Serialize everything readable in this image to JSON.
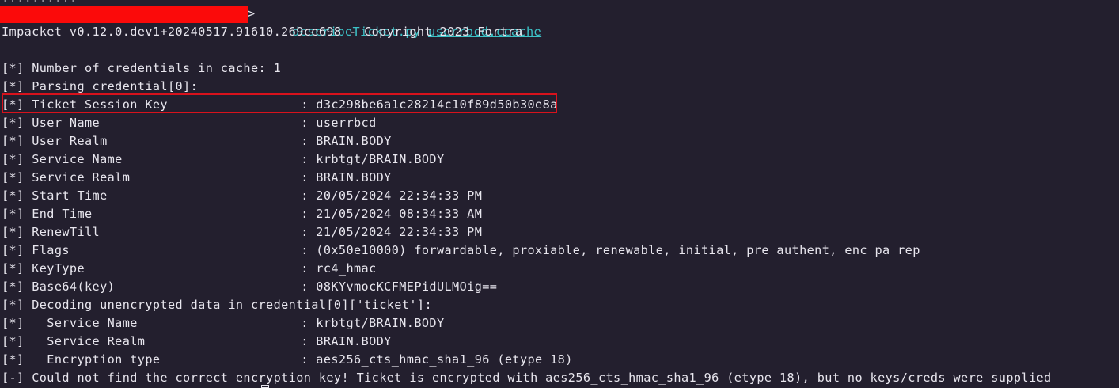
{
  "terminal": {
    "previous_line_fragment": "..........",
    "prompt_arrow": ">",
    "command_name": "describeTicket.py",
    "command_arg": "userrbcd.ccache",
    "banner": "Impacket v0.12.0.dev1+20240517.91610.269ce698 - Copyright 2023 Fortra",
    "lines": [
      {
        "prefix": "[*]",
        "label": "Number of credentials in cache: 1",
        "value": ""
      },
      {
        "prefix": "[*]",
        "label": "Parsing credential[0]:",
        "value": ""
      },
      {
        "prefix": "[*]",
        "label": "Ticket Session Key",
        "value": ": d3c298be6a1c28214c10f89d50b30e8a"
      },
      {
        "prefix": "[*]",
        "label": "User Name",
        "value": ": userrbcd"
      },
      {
        "prefix": "[*]",
        "label": "User Realm",
        "value": ": BRAIN.BODY"
      },
      {
        "prefix": "[*]",
        "label": "Service Name",
        "value": ": krbtgt/BRAIN.BODY"
      },
      {
        "prefix": "[*]",
        "label": "Service Realm",
        "value": ": BRAIN.BODY"
      },
      {
        "prefix": "[*]",
        "label": "Start Time",
        "value": ": 20/05/2024 22:34:33 PM"
      },
      {
        "prefix": "[*]",
        "label": "End Time",
        "value": ": 21/05/2024 08:34:33 AM"
      },
      {
        "prefix": "[*]",
        "label": "RenewTill",
        "value": ": 21/05/2024 22:34:33 PM"
      },
      {
        "prefix": "[*]",
        "label": "Flags",
        "value": ": (0x50e10000) forwardable, proxiable, renewable, initial, pre_authent, enc_pa_rep"
      },
      {
        "prefix": "[*]",
        "label": "KeyType",
        "value": ": rc4_hmac"
      },
      {
        "prefix": "[*]",
        "label": "Base64(key)",
        "value": ": 08KYvmocKCFMEPidULMOig=="
      },
      {
        "prefix": "[*]",
        "label": "Decoding unencrypted data in credential[0]['ticket']:",
        "value": ""
      },
      {
        "prefix": "[*]",
        "label": "  Service Name",
        "value": ": krbtgt/BRAIN.BODY"
      },
      {
        "prefix": "[*]",
        "label": "  Service Realm",
        "value": ": BRAIN.BODY"
      },
      {
        "prefix": "[*]",
        "label": "  Encryption type",
        "value": ": aes256_cts_hmac_sha1_96 (etype 18)"
      },
      {
        "prefix": "[-]",
        "label": "Could not find the correct encryption key! Ticket is encrypted with aes256_cts_hmac_sha1_96 (etype 18), but no keys/creds were supplied",
        "value": ""
      }
    ]
  },
  "colors": {
    "background": "#231f2e",
    "text": "#e8e6ee",
    "command": "#3cc2c7",
    "redaction": "#fb0a0a",
    "highlight_border": "#d8121c"
  }
}
